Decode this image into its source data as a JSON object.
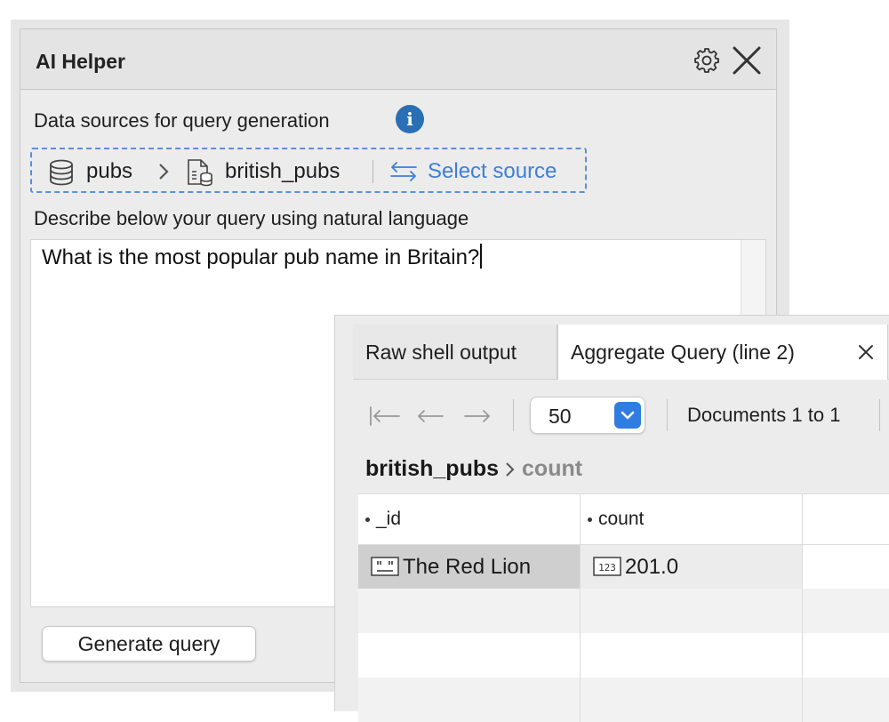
{
  "helper": {
    "title": "AI Helper",
    "data_sources_label": "Data sources for query generation",
    "source": {
      "database": "pubs",
      "collection": "british_pubs",
      "select_source_label": "Select source"
    },
    "describe_label": "Describe below your query using natural language",
    "query_text": "What is the most popular pub name in Britain?",
    "generate_button": "Generate query"
  },
  "results": {
    "tabs": [
      {
        "label": "Raw shell output",
        "active": false
      },
      {
        "label": "Aggregate Query (line 2)",
        "active": true
      }
    ],
    "page_size": "50",
    "documents_range": "Documents 1 to 1",
    "breadcrumb": {
      "collection": "british_pubs",
      "field": "count"
    },
    "columns": [
      "_id",
      "count"
    ],
    "rows": [
      {
        "_id": "The Red Lion",
        "count": "201.0"
      }
    ]
  },
  "colors": {
    "accent_blue": "#2f7de1",
    "link_blue": "#3d7fd8",
    "info_blue": "#2a6fb3"
  },
  "icons": [
    "gear-icon",
    "close-icon",
    "info-icon",
    "database-icon",
    "collection-icon",
    "swap-icon",
    "string-type-icon",
    "number-type-icon"
  ]
}
